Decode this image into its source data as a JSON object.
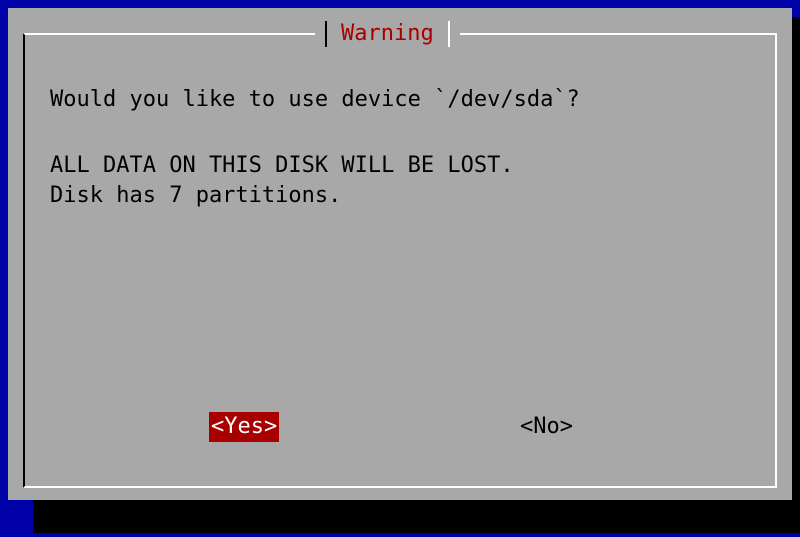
{
  "dialog": {
    "title": "Warning",
    "question": "Would you like to use device `/dev/sda`?",
    "warning_line": "ALL DATA ON THIS DISK WILL BE LOST.",
    "info_line": "Disk has 7 partitions."
  },
  "buttons": {
    "yes_label": "<Yes>",
    "no_label": "<No>"
  },
  "colors": {
    "background": "#0000a8",
    "dialog": "#a8a8a8",
    "title": "#a80000",
    "selected_button": "#a80000"
  }
}
